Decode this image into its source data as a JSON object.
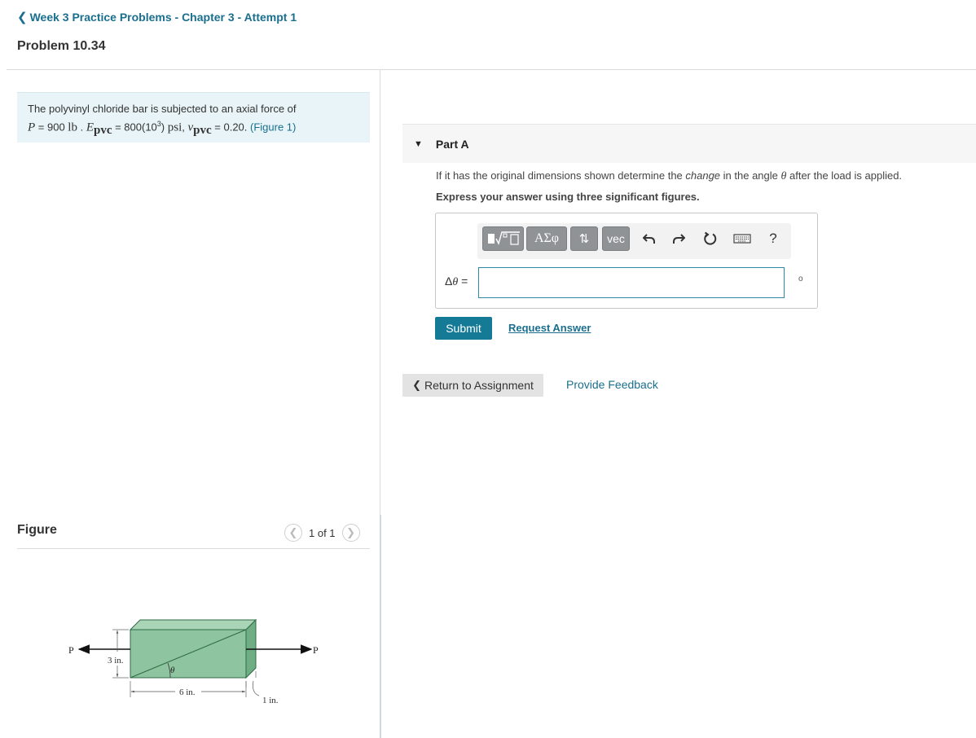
{
  "breadcrumb": {
    "label": "Week 3 Practice Problems - Chapter 3 - Attempt 1"
  },
  "problem": {
    "title": "Problem 10.34"
  },
  "statement": {
    "intro": "The polyvinyl chloride bar is subjected to an axial force of",
    "P_var": "P",
    "P_eq": " = 900 ",
    "P_unit": "lb",
    "sep1": " . ",
    "E_var": "E",
    "E_sub": "pvc",
    "E_eq": " = 800(10",
    "E_exp": "3",
    "E_close": ") ",
    "E_unit": "psi",
    "sep2": ", ",
    "nu_var": "ν",
    "nu_sub": "pvc",
    "nu_eq": " = 0.20. ",
    "figure_link": "(Figure 1)"
  },
  "figure": {
    "heading": "Figure",
    "pager": {
      "count": "1 of 1",
      "prev_icon": "chevron-left-icon",
      "next_icon": "chevron-right-icon"
    },
    "labels": {
      "P_left": "P",
      "P_right": "P",
      "height": "3 in.",
      "length": "6 in.",
      "depth": "1 in.",
      "angle": "θ"
    },
    "colors": {
      "block_front": "#8ec4a0",
      "block_top": "#a9d4b6",
      "block_side": "#6fae84",
      "block_edge": "#2f6b45"
    }
  },
  "part": {
    "label": "Part A",
    "question_pre": "If it has the original dimensions shown determine the ",
    "question_emph": "change",
    "question_mid": " in the angle ",
    "question_theta": "θ",
    "question_post": " after the load is applied.",
    "instruction": "Express your answer using three significant figures.",
    "toolbar": {
      "templates_icon": "fraction-sqrt-template-icon",
      "greek": "ΑΣφ",
      "arrows": "⇅",
      "vec": "vec",
      "undo_icon": "undo-icon",
      "redo_icon": "redo-icon",
      "reset_icon": "reset-icon",
      "keyboard_icon": "keyboard-icon",
      "help": "?"
    },
    "answer_label_delta": "Δ",
    "answer_label_theta": "θ",
    "answer_label_eq": " =",
    "answer_value": "",
    "unit": "o",
    "submit_label": "Submit",
    "request_label": "Request Answer"
  },
  "footer": {
    "return_label": "Return to Assignment",
    "feedback_label": "Provide Feedback"
  },
  "colors": {
    "link": "#1a6f8f",
    "submit": "#157a96",
    "statement_bg": "#e8f4f7",
    "input_border": "#2b8aa5"
  }
}
